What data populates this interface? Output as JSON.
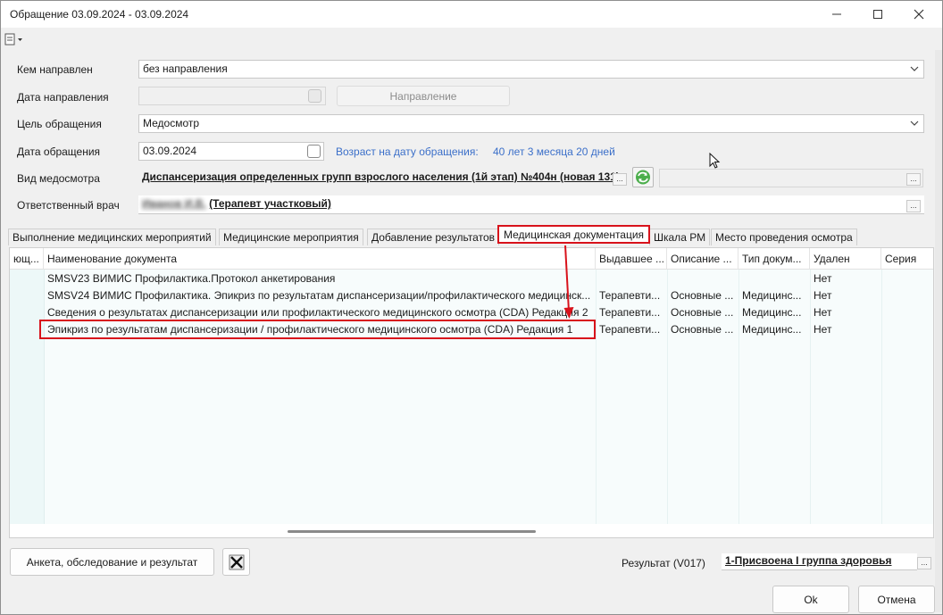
{
  "window": {
    "title": "Обращение 03.09.2024 - 03.09.2024",
    "minimize_icon": "minimize-icon",
    "maximize_icon": "maximize-icon",
    "close_icon": "close-icon"
  },
  "toolbar": {
    "menu_icon": "document-menu-icon"
  },
  "form": {
    "directed_by_label": "Кем направлен",
    "directed_by_value": "без направления",
    "direction_date_label": "Дата направления",
    "direction_date_value": "",
    "direction_button": "Направление",
    "purpose_label": "Цель обращения",
    "purpose_value": "Медосмотр",
    "visit_date_label": "Дата обращения",
    "visit_date_value": "03.09.2024",
    "age_label": "Возраст на дату обращения:",
    "age_value": "40 лет 3 месяца 20 дней",
    "exam_type_label": "Вид медосмотра",
    "exam_type_value": "Диспансеризация определенных групп взрослого населения (1й этап) №404н (новая 131)",
    "doctor_label": "Ответственный врач",
    "doctor_name": "Иванов И.В.",
    "doctor_role": "(Терапевт участковый)",
    "ellipsis": "..."
  },
  "tabs": [
    {
      "label": "Выполнение медицинских мероприятий"
    },
    {
      "label": "Медицинские мероприятия"
    },
    {
      "label": "Добавление результатов"
    },
    {
      "label": "Медицинская документация"
    },
    {
      "label": "Шкала РМ"
    },
    {
      "label": "Место проведения осмотра"
    }
  ],
  "grid": {
    "columns": [
      "ющ...",
      "Наименование документа",
      "Выдавшее ...",
      "Описание ...",
      "Тип докум...",
      "Удален",
      "Серия"
    ],
    "rows": [
      {
        "name": "SMSV23 ВИМИС Профилактика.Протокол анкетирования",
        "issuer": "",
        "desc": "",
        "type": "",
        "deleted": "Нет"
      },
      {
        "name": "SMSV24 ВИМИС Профилактика. Эпикриз по результатам диспансеризации/профилактического медицинск...",
        "issuer": "Терапевти...",
        "desc": "Основные ...",
        "type": "Медицинс...",
        "deleted": "Нет"
      },
      {
        "name": "Сведения о результатах диспансеризации или профилактического медицинского осмотра (CDA) Редакция 2",
        "issuer": "Терапевти...",
        "desc": "Основные ...",
        "type": "Медицинс...",
        "deleted": "Нет"
      },
      {
        "name": "Эпикриз по результатам диспансеризации / профилактического медицинского осмотра (CDA) Редакция 1",
        "issuer": "Терапевти...",
        "desc": "Основные ...",
        "type": "Медицинс...",
        "deleted": "Нет"
      }
    ]
  },
  "footer": {
    "survey_button": "Анкета, обследование и результат",
    "clear_icon": "clear-x-icon",
    "result_label": "Результат (V017)",
    "result_value": "1-Присвоена I группа здоровья",
    "ok_button": "Ok",
    "cancel_button": "Отмена"
  },
  "colors": {
    "accent_red": "#d8121b",
    "link_blue": "#3b6fc9",
    "row_tint": "#edf8f8"
  }
}
